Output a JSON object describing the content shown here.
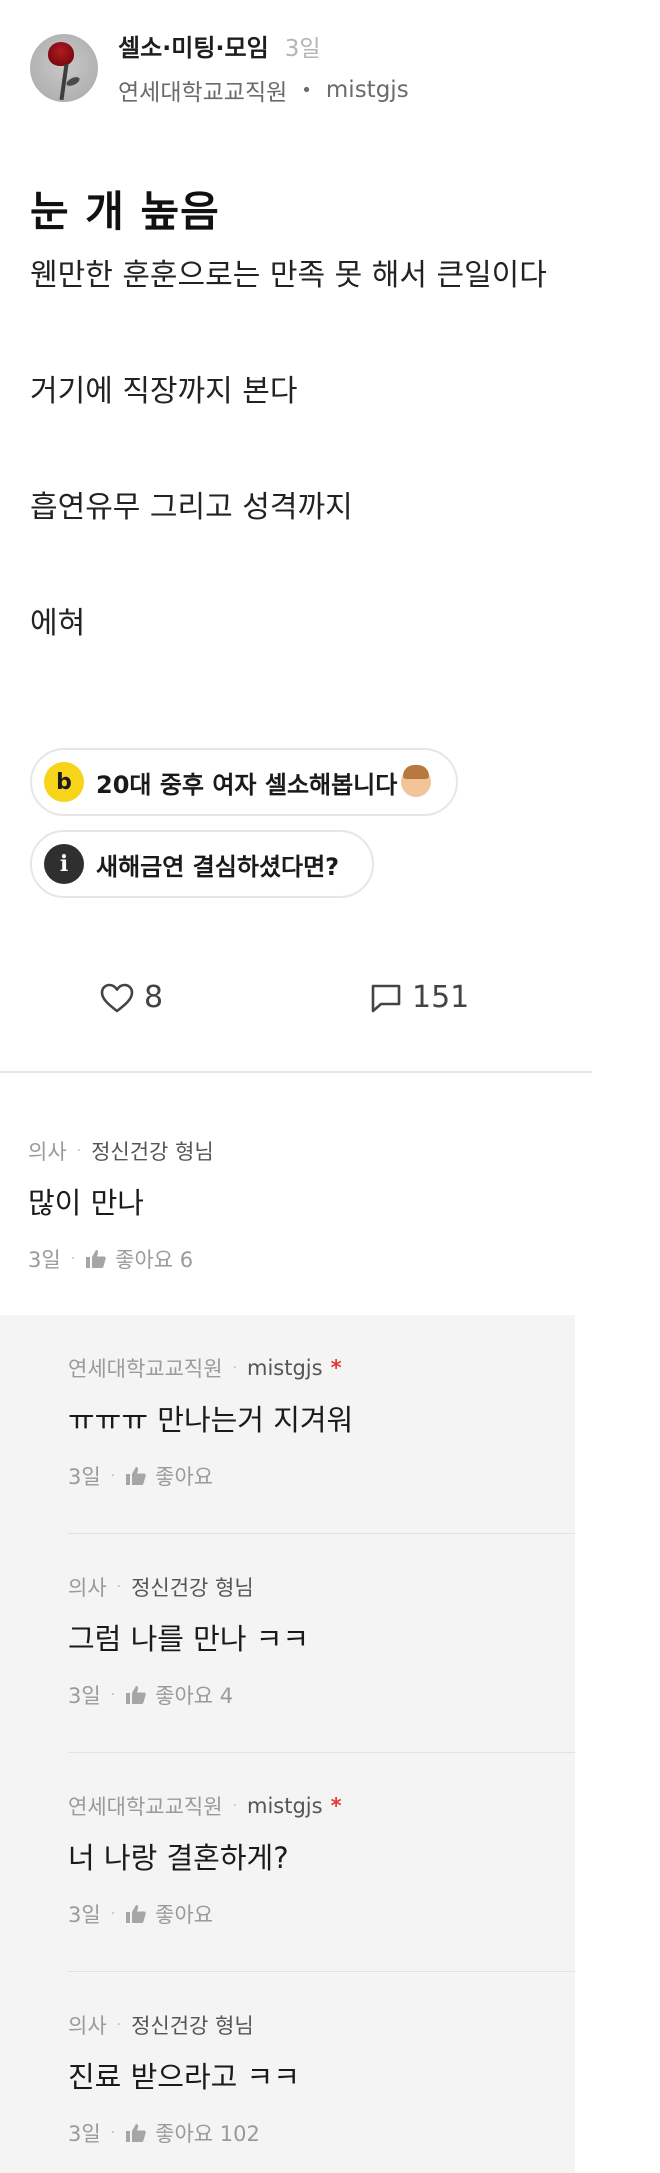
{
  "post": {
    "board": "셀소·미팅·모임",
    "time": "3일",
    "company": "연세대학교교직원",
    "separator": "•",
    "nickname": "mistgjs",
    "title": "눈 개 높음",
    "body": [
      "웬만한 훈훈으로는 만족 못 해서 큰일이다",
      "거기에 직장까지 본다",
      "흡연유무 그리고 성격까지",
      "에혀"
    ]
  },
  "related": [
    {
      "icon_text": "b",
      "label": "20대 중후 여자 셀소해봅니다"
    },
    {
      "icon_text": "i",
      "label": "새해금연 결심하셨다면?"
    }
  ],
  "actions": {
    "likes": "8",
    "comments": "151"
  },
  "comments": {
    "main": {
      "company": "의사",
      "sep": "·",
      "author": "정신건강 형님",
      "text": "많이 만나",
      "time": "3일",
      "like_label": "좋아요 6"
    },
    "replies": [
      {
        "company": "연세대학교교직원",
        "sep": "·",
        "author": "mistgjs",
        "op_mark": "*",
        "text": "ㅠㅠㅠ 만나는거 지겨워",
        "time": "3일",
        "like_label": "좋아요"
      },
      {
        "company": "의사",
        "sep": "·",
        "author": "정신건강 형님",
        "op_mark": "",
        "text": "그럼 나를 만나 ㅋㅋ",
        "time": "3일",
        "like_label": "좋아요 4"
      },
      {
        "company": "연세대학교교직원",
        "sep": "·",
        "author": "mistgjs",
        "op_mark": "*",
        "text": "너 나랑 결혼하게?",
        "time": "3일",
        "like_label": "좋아요"
      },
      {
        "company": "의사",
        "sep": "·",
        "author": "정신건강 형님",
        "op_mark": "",
        "text": "진료 받으라고 ㅋㅋ",
        "time": "3일",
        "like_label": "좋아요 102"
      }
    ]
  },
  "icons": {
    "like": "heart-outline-icon",
    "comment": "speech-bubble-icon",
    "thumb": "thumbs-up-icon"
  },
  "colors": {
    "op_mark": "#e53935",
    "chip_badge_yellow": "#f7d31a",
    "chip_badge_dark": "#2f2f2f",
    "reply_background": "#f4f4f4"
  }
}
